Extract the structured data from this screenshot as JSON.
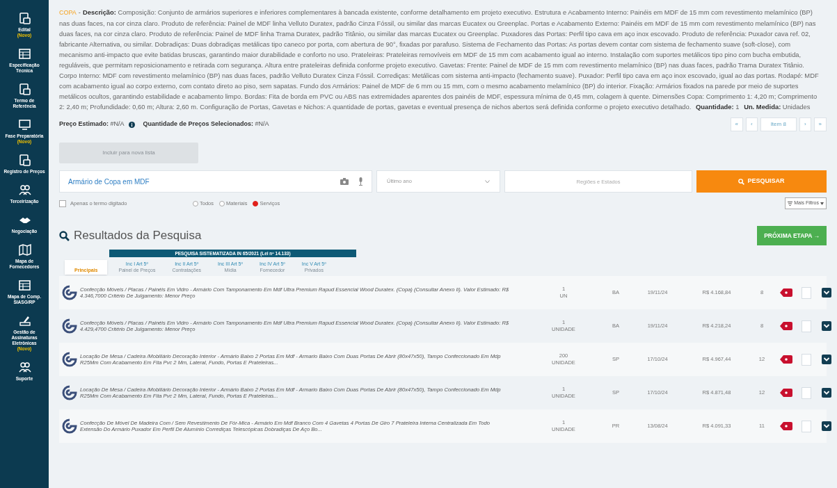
{
  "sidebar": {
    "items": [
      {
        "label": "Edital",
        "tag": "(Novo)"
      },
      {
        "label": "Especificação Técnica"
      },
      {
        "label": "Termo de Referência"
      },
      {
        "label": "Fase Preparatória",
        "tag": "(Novo)"
      },
      {
        "label": "Registro de Preços"
      },
      {
        "label": "Terceirização"
      },
      {
        "label": "Negociação"
      },
      {
        "label": "Mapa de Fornecedores"
      },
      {
        "label": "Mapa de Comp. SIASG/RP"
      },
      {
        "label": "Gestão de Assinaturas Eletrônicas",
        "tag": "(Novo)"
      },
      {
        "label": "Suporte"
      }
    ]
  },
  "item": {
    "category": "COPA",
    "separator": "-",
    "description_label": "Descrição:",
    "description": "Composição: Conjunto de armários superiores e inferiores complementares à bancada existente, conforme detalhamento em projeto executivo. Estrutura e Acabamento Interno: Painéis em MDF de 15 mm com revestimento melamínico (BP) nas duas faces, na cor cinza claro. Produto de referência: Painel de MDF linha Velluto Duratex, padrão Cinza Fóssil, ou similar das marcas Eucatex ou Greenplac. Portas e Acabamento Externo: Painéis em MDF de 15 mm com revestimento melamínico (BP) nas duas faces, na cor cinza claro. Produto de referência: Painel de MDF linha Trama Duratex, padrão Titânio, ou similar das marcas Eucatex ou Greenplac. Puxadores das Portas: Perfil tipo cava em aço inox escovado. Produto de referência: Puxador cava ref. 02, fabricante Alternativa, ou similar. Dobradiças: Duas dobradiças metálicas tipo caneco por porta, com abertura de 90°, fixadas por parafuso. Sistema de Fechamento das Portas: As portas devem contar com sistema de fechamento suave (soft-close), com mecanismo anti-impacto que evite batidas bruscas, garantindo maior durabilidade e conforto no uso. Prateleiras: Prateleiras removíveis em MDF de 15 mm com acabamento igual ao interno. Instalação com suportes metálicos tipo pino com bucha embutida, reguláveis, que permitam reposicionamento e retirada com segurança. Altura entre prateleiras definida conforme projeto executivo. Gavetas: Frente: Painel de MDF de 15 mm com revestimento melamínico (BP) nas duas faces, padrão Trama Duratex Titânio. Corpo Interno: MDF com revestimento melamínico (BP) nas duas faces, padrão Velluto Duratex Cinza Fóssil. Corrediças: Metálicas com sistema anti-impacto (fechamento suave). Puxador: Perfil tipo cava em aço inox escovado, igual ao das portas. Rodapé: MDF com acabamento igual ao corpo externo, com contato direto ao piso, sem sapatas. Fundo dos Armários: Painel de MDF de 6 mm ou 15 mm, com o mesmo acabamento melamínico (BP) do interior. Fixação: Armários fixados na parede por meio de suportes metálicos ocultos, garantindo estabilidade e acabamento limpo. Bordas: Fita de borda em PVC ou ABS nas extremidades aparentes dos painéis de MDF, espessura mínima de 0,45 mm, colagem à quente. Dimensões Copa: Comprimento 1: 4,20 m; Comprimento 2: 2,40 m; Profundidade: 0,60 m; Altura: 2,60 m. Configuração de Portas, Gavetas e Nichos: A quantidade de portas, gavetas e eventual presença de nichos abertos será definida conforme o projeto executivo detalhado.",
    "quantity_label": "Quantidade:",
    "quantity": "1",
    "unit_label": "Un. Medida:",
    "unit": "Unidades",
    "price_label": "Preço Estimado:",
    "price": "#N/A",
    "selected_label": "Quantidade de Preços Selecionados:",
    "selected": "#N/A"
  },
  "pagination": {
    "first": "«",
    "prev": "‹",
    "current": "Item 8",
    "next": "›",
    "last": "»"
  },
  "action_button": {
    "label": "Incluir para nova lista",
    "disabled": true
  },
  "search": {
    "value": "Armário de Copa em MDF",
    "period": "Último ano",
    "region_placeholder": "Regiões e Estados",
    "button": "PESQUISAR",
    "exact_label": "Apenas o termo digitado",
    "exact_checked": false,
    "types": [
      {
        "label": "Todos",
        "selected": false
      },
      {
        "label": "Materiais",
        "selected": false
      },
      {
        "label": "Serviços",
        "selected": true
      }
    ],
    "more_filters": "Mais Filtros"
  },
  "results": {
    "title": "Resultados da Pesquisa",
    "next_button": "PRÓXIMA ETAPA →",
    "banner": "PESQUISA SISTEMATIZADA IN 65/2021 (Lei nº 14.133)",
    "tabs": [
      {
        "label": "Principais",
        "selected": true
      },
      {
        "label": "Inc I Art 5º",
        "sub": "Painel de Preços",
        "selected": false
      },
      {
        "label": "Inc II Art 5º",
        "sub": "Contratações",
        "selected": false
      },
      {
        "label": "Inc III Art 5º",
        "sub": "Mídia",
        "selected": false
      },
      {
        "label": "Inc IV Art 5º",
        "sub": "Fornecedor",
        "selected": false
      },
      {
        "label": "Inc V Art 5º",
        "sub": "Privados",
        "selected": false
      }
    ],
    "rows": [
      {
        "description": "Confecção Móveis / Placas / Painéis Em Vidro - Armário Com Tamponamento Em Mdf Ultra Premium Rapud Essencial Wood Duratex. (Copa) (Consultar Anexo Ii). Valor Estimado: R$ 4.346,7000 Critério De Julgamento: Menor Preço",
        "quantity": "1",
        "unit": "UN",
        "state": "BA",
        "date": "19/11/24",
        "price": "R$ 4.168,84",
        "count": "8",
        "checked": false
      },
      {
        "description": "Confecção Móveis / Placas / Painéis Em Vidro - Armário Com Tamponamento Em Mdf Ultra Premium Rapud Essencial Wood Duratex. (Copa) (Consultar Anexo Ii). Valor Estimado: R$ 4.429,4700 Critério De Julgamento: Menor Preço",
        "quantity": "1",
        "unit": "UNIDADE",
        "state": "BA",
        "date": "19/11/24",
        "price": "R$ 4.218,24",
        "count": "8",
        "checked": false
      },
      {
        "description": "Locação De Mesa / Cadeira /Mobiliário Decoração Interior - Armário Baixo 2 Portas Em Mdf - Armario Baixo Com Duas Portas De Abrir (80x47x50), Tampo Confeccionado Em Mdp R25Mm Com Acabamento Em Fita Pvc 2 Mm, Lateral, Fundo, Portas E Prateleiras...",
        "quantity": "200",
        "unit": "UNIDADE",
        "state": "SP",
        "date": "17/10/24",
        "price": "R$ 4.967,44",
        "count": "12",
        "checked": false
      },
      {
        "description": "Locação De Mesa / Cadeira /Mobiliário Decoração Interior - Armário Baixo 2 Portas Em Mdf - Armario Baixo Com Duas Portas De Abrir (80x47x50), Tampo Confeccionado Em Mdp R25Mm Com Acabamento Em Fita Pvc 2 Mm, Lateral, Fundo, Portas E Prateleiras...",
        "quantity": "1",
        "unit": "UNIDADE",
        "state": "SP",
        "date": "17/10/24",
        "price": "R$ 4.871,48",
        "count": "12",
        "checked": false
      },
      {
        "description": "Confecção De Móvel De Madeira Com / Sem Revestimento De Fór-Mica - Armário Em Mdf Branco Com 4 Gavetas 4 Portas De Giro 7 Prateleira Interna Centralizada Em Todo Extensão Do Armário Puxador Em Perfil De Alumínio Corrediças Telescópicas Dobradiças De Aço Bo...",
        "quantity": "1",
        "unit": "UNIDADE",
        "state": "PR",
        "date": "13/08/24",
        "price": "R$ 4.091,33",
        "count": "11",
        "checked": false
      }
    ]
  }
}
